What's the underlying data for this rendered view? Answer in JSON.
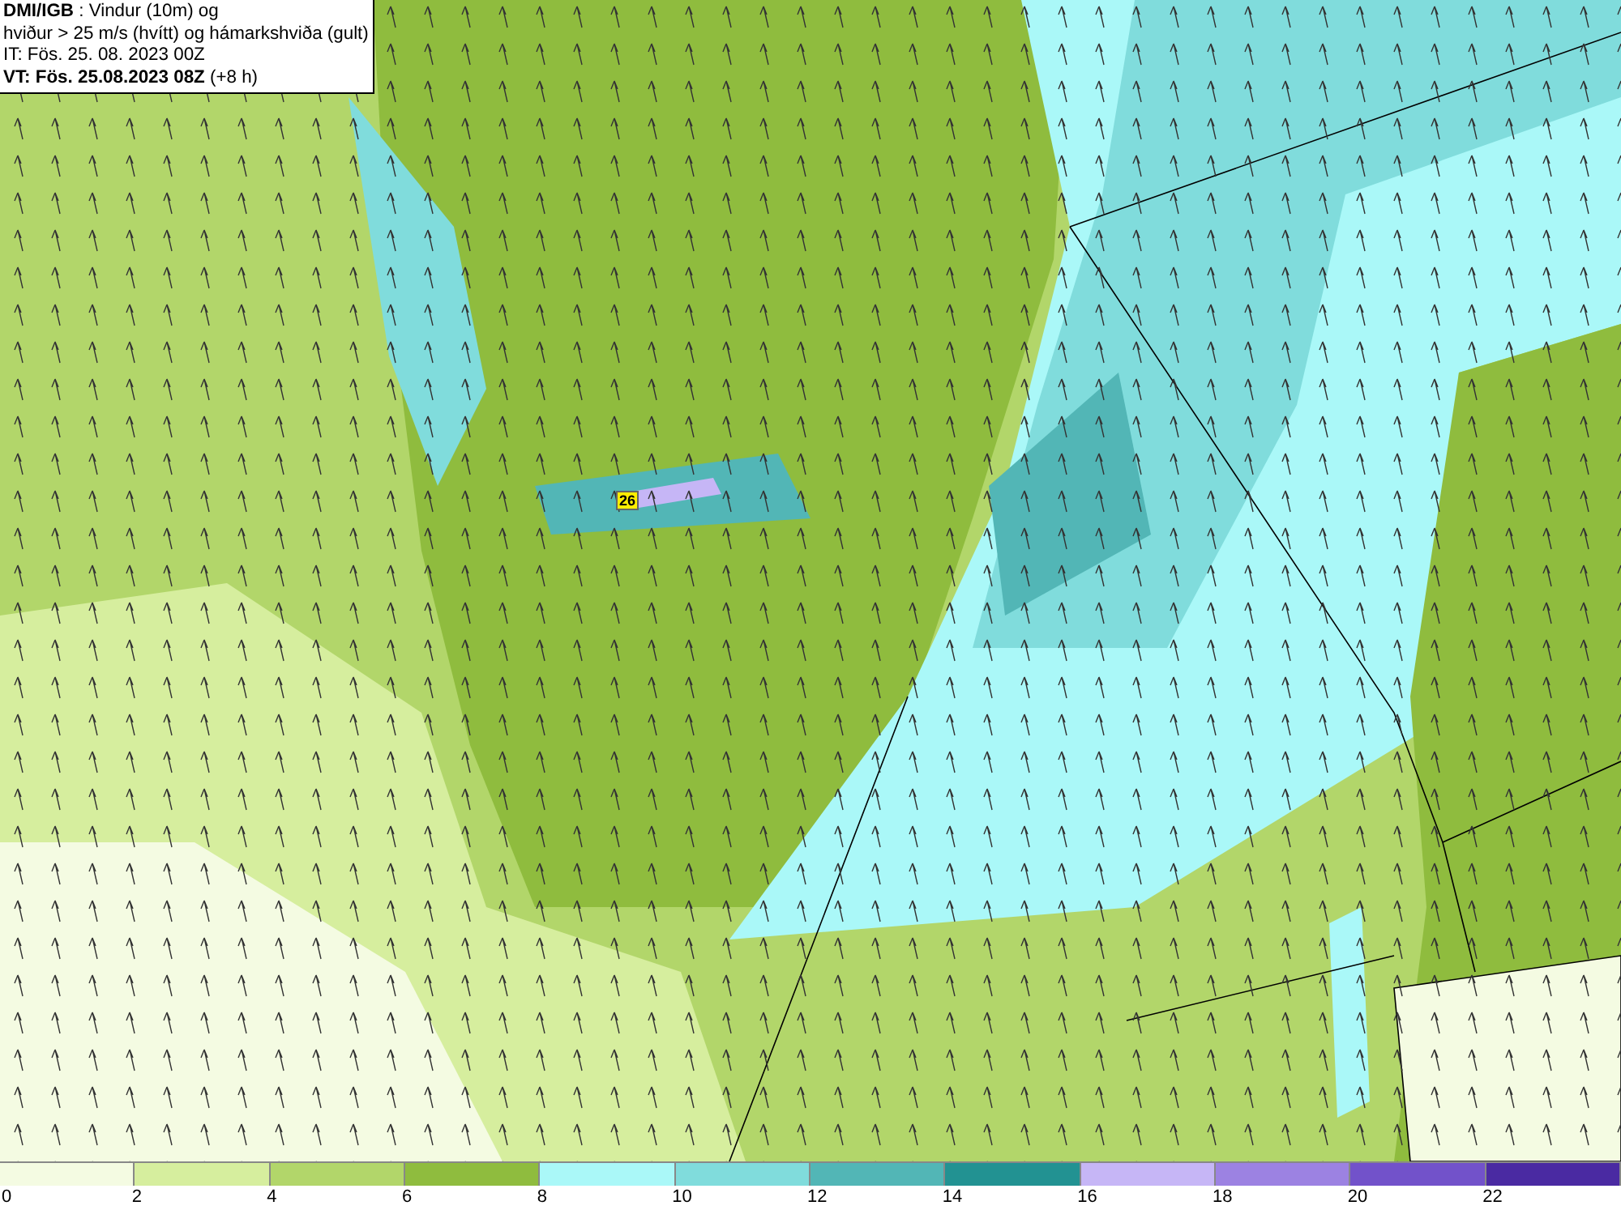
{
  "title_box": {
    "lines": [
      "**DMI/IGB** : Vindur (10m) og",
      "hviður > 25 m/s (hvítt) og hámarkshviða (gult)",
      "IT: Fös. 25. 08. 2023 00Z",
      "**VT: Fös. 25.08.2023 08Z** (+8 h)"
    ]
  },
  "gust_labels": [
    {
      "value": "26"
    }
  ],
  "legend": {
    "bins": [
      {
        "color": "#f4fbe2"
      },
      {
        "color": "#d6ee9e"
      },
      {
        "color": "#b2d66a"
      },
      {
        "color": "#8fbc3e"
      },
      {
        "color": "#aaf8f8"
      },
      {
        "color": "#80dcdc"
      },
      {
        "color": "#52b6b6"
      },
      {
        "color": "#229292"
      },
      {
        "color": "#c6b6f6"
      },
      {
        "color": "#9c82e2"
      },
      {
        "color": "#7252ca"
      },
      {
        "color": "#4a2aa2"
      }
    ],
    "ticks": [
      "0",
      "2",
      "4",
      "6",
      "8",
      "10",
      "12",
      "14",
      "16",
      "18",
      "20",
      "22"
    ]
  }
}
